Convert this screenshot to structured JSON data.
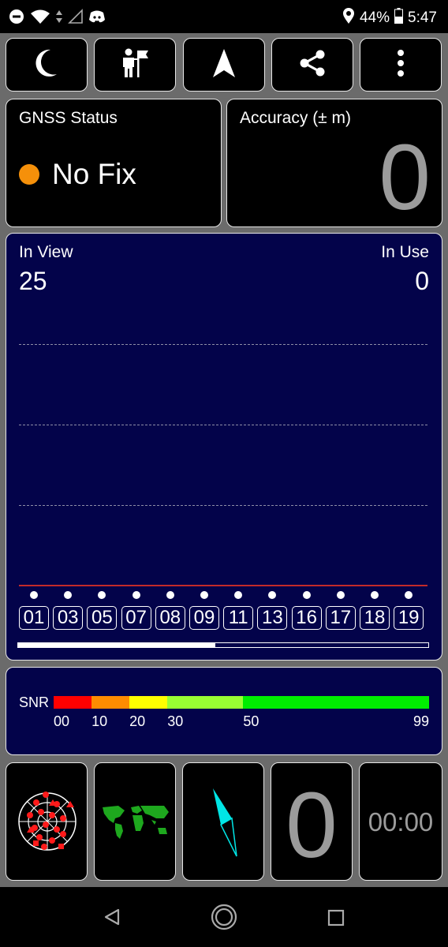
{
  "status_bar": {
    "battery": "44%",
    "time": "5:47",
    "icons": [
      "do-not-disturb-icon",
      "wifi-icon",
      "data-arrows-icon",
      "no-signal-icon",
      "discord-icon",
      "location-icon",
      "battery-icon"
    ]
  },
  "toolbar": {
    "buttons": [
      {
        "name": "night-mode",
        "icon": "moon-icon"
      },
      {
        "name": "flag-person",
        "icon": "person-flag-icon"
      },
      {
        "name": "navigation",
        "icon": "navigation-arrow-icon"
      },
      {
        "name": "share",
        "icon": "share-icon"
      },
      {
        "name": "more",
        "icon": "more-vert-icon"
      }
    ]
  },
  "gnss_status": {
    "title": "GNSS Status",
    "fix_text": "No Fix",
    "fix_color": "#f5900a"
  },
  "accuracy": {
    "title": "Accuracy (± m)",
    "value": "0"
  },
  "satellites": {
    "in_view_label": "In View",
    "in_view_value": "25",
    "in_use_label": "In Use",
    "in_use_value": "0",
    "ids": [
      "01",
      "03",
      "05",
      "07",
      "08",
      "09",
      "11",
      "13",
      "16",
      "17",
      "18",
      "19"
    ],
    "scroll_fraction": 0.48
  },
  "snr": {
    "label": "SNR",
    "ticks": [
      "00",
      "10",
      "20",
      "30",
      "50",
      "99"
    ],
    "segments": [
      {
        "from": 0,
        "to": 10,
        "color": "#ff0000"
      },
      {
        "from": 10,
        "to": 20,
        "color": "#ff8c00"
      },
      {
        "from": 20,
        "to": 30,
        "color": "#ffff00"
      },
      {
        "from": 30,
        "to": 50,
        "color": "#99ff33"
      },
      {
        "from": 50,
        "to": 99,
        "color": "#00ee00"
      }
    ]
  },
  "bottom_tiles": {
    "speed_value": "0",
    "timer_value": "00:00",
    "icons": [
      "sky-plot-icon",
      "world-map-icon",
      "compass-icon"
    ]
  },
  "nav_bar": {
    "icons": [
      "back-icon",
      "home-icon",
      "recents-icon"
    ]
  },
  "colors": {
    "card_navy": "#03034a",
    "value_gray": "#9b9b9b"
  }
}
